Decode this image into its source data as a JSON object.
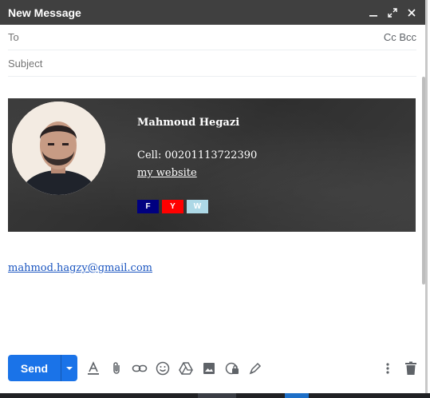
{
  "window": {
    "title": "New Message"
  },
  "fields": {
    "to_placeholder": "To",
    "cc_bcc": "Cc Bcc",
    "subject_placeholder": "Subject"
  },
  "signature": {
    "name": "Mahmoud Hegazi",
    "cell": "Cell: 00201113722390",
    "website": "my website",
    "social": [
      {
        "label": "F",
        "bg": "#000080",
        "fg": "#ffffff"
      },
      {
        "label": "Y",
        "bg": "#ff0000",
        "fg": "#ffffff"
      },
      {
        "label": "W",
        "bg": "#add8e6",
        "fg": "#ffffff"
      }
    ]
  },
  "email": "mahmod.hagzy@gmail.com",
  "toolbar": {
    "send_label": "Send",
    "icons": [
      "format-text-icon",
      "attach-icon",
      "link-icon",
      "emoji-icon",
      "drive-icon",
      "photo-icon",
      "confidential-icon",
      "signature-icon"
    ],
    "more_icon": "more-vert-icon",
    "discard_icon": "trash-icon"
  },
  "colors": {
    "titlebar": "#404040",
    "send": "#1a73e8",
    "link": "#1a55c0"
  }
}
